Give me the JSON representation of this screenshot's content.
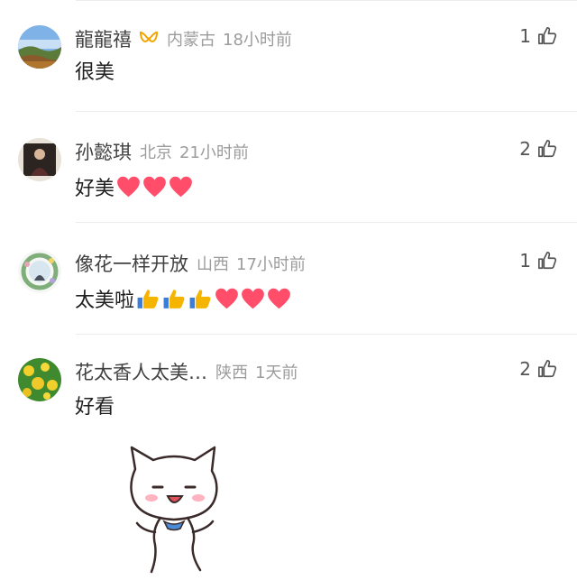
{
  "comments": [
    {
      "name": "龍龍禧",
      "has_badge": true,
      "location": "内蒙古",
      "time": "18小时前",
      "text": "很美",
      "emojis": [],
      "likes": "1",
      "avatar_icon": "landscape-avatar"
    },
    {
      "name": "孙懿琪",
      "has_badge": false,
      "location": "北京",
      "time": "21小时前",
      "text": "好美",
      "emojis": [
        "heart",
        "heart",
        "heart"
      ],
      "likes": "2",
      "avatar_icon": "portrait-avatar"
    },
    {
      "name": "像花一样开放",
      "has_badge": false,
      "location": "山西",
      "time": "17小时前",
      "text": "太美啦",
      "emojis": [
        "thumbs-up",
        "thumbs-up",
        "thumbs-up",
        "heart",
        "heart",
        "heart"
      ],
      "likes": "1",
      "avatar_icon": "flower-wreath-avatar"
    },
    {
      "name": "花太香人太美…",
      "has_badge": false,
      "location": "陕西",
      "time": "1天前",
      "text": "好看",
      "emojis": [],
      "likes": "2",
      "avatar_icon": "yellow-flower-avatar"
    }
  ],
  "sticker": {
    "icon": "dancing-cat-sticker"
  },
  "colors": {
    "name": "#414141",
    "meta": "#9c9c9c",
    "body": "#1f1f1f",
    "heart": "#ff4d6a",
    "thumb": "#f5b400",
    "badge": "#f0a500"
  }
}
